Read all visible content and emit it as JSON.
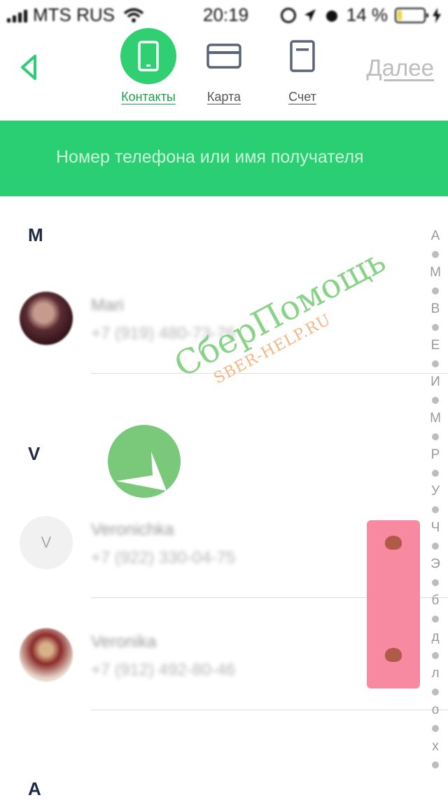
{
  "status_bar": {
    "carrier": "MTS RUS",
    "time": "20:19",
    "battery": "14 %"
  },
  "header": {
    "tabs": [
      {
        "label": "Контакты",
        "icon": "phone-icon",
        "active": true
      },
      {
        "label": "Карта",
        "icon": "card-icon",
        "active": false
      },
      {
        "label": "Счет",
        "icon": "document-icon",
        "active": false
      }
    ],
    "next_label": "Далее"
  },
  "search": {
    "placeholder": "Номер телефона или имя получателя"
  },
  "sections": [
    {
      "letter": "M",
      "contacts": [
        {
          "name": "Mari",
          "phone": "+7 (919) 480-73-76"
        }
      ]
    },
    {
      "letter": "V",
      "contacts": [
        {
          "name": "Veronichka",
          "phone": "+7 (922) 330-04-75",
          "initial": "V"
        },
        {
          "name": "Veronika",
          "phone": "+7 (912) 492-80-46"
        }
      ]
    },
    {
      "letter": "A"
    }
  ],
  "alphabet_index": [
    "А",
    "М",
    "В",
    "Е",
    "И",
    "М",
    "Р",
    "У",
    "Ч",
    "Э",
    "б",
    "д",
    "л",
    "о",
    "х"
  ],
  "watermark": {
    "title": "СберПомощь",
    "subtitle": "SBER-HELP.RU"
  },
  "colors": {
    "accent": "#2bcf73",
    "accent_dark": "#1d9d4d",
    "badge": "#f78aa0"
  }
}
